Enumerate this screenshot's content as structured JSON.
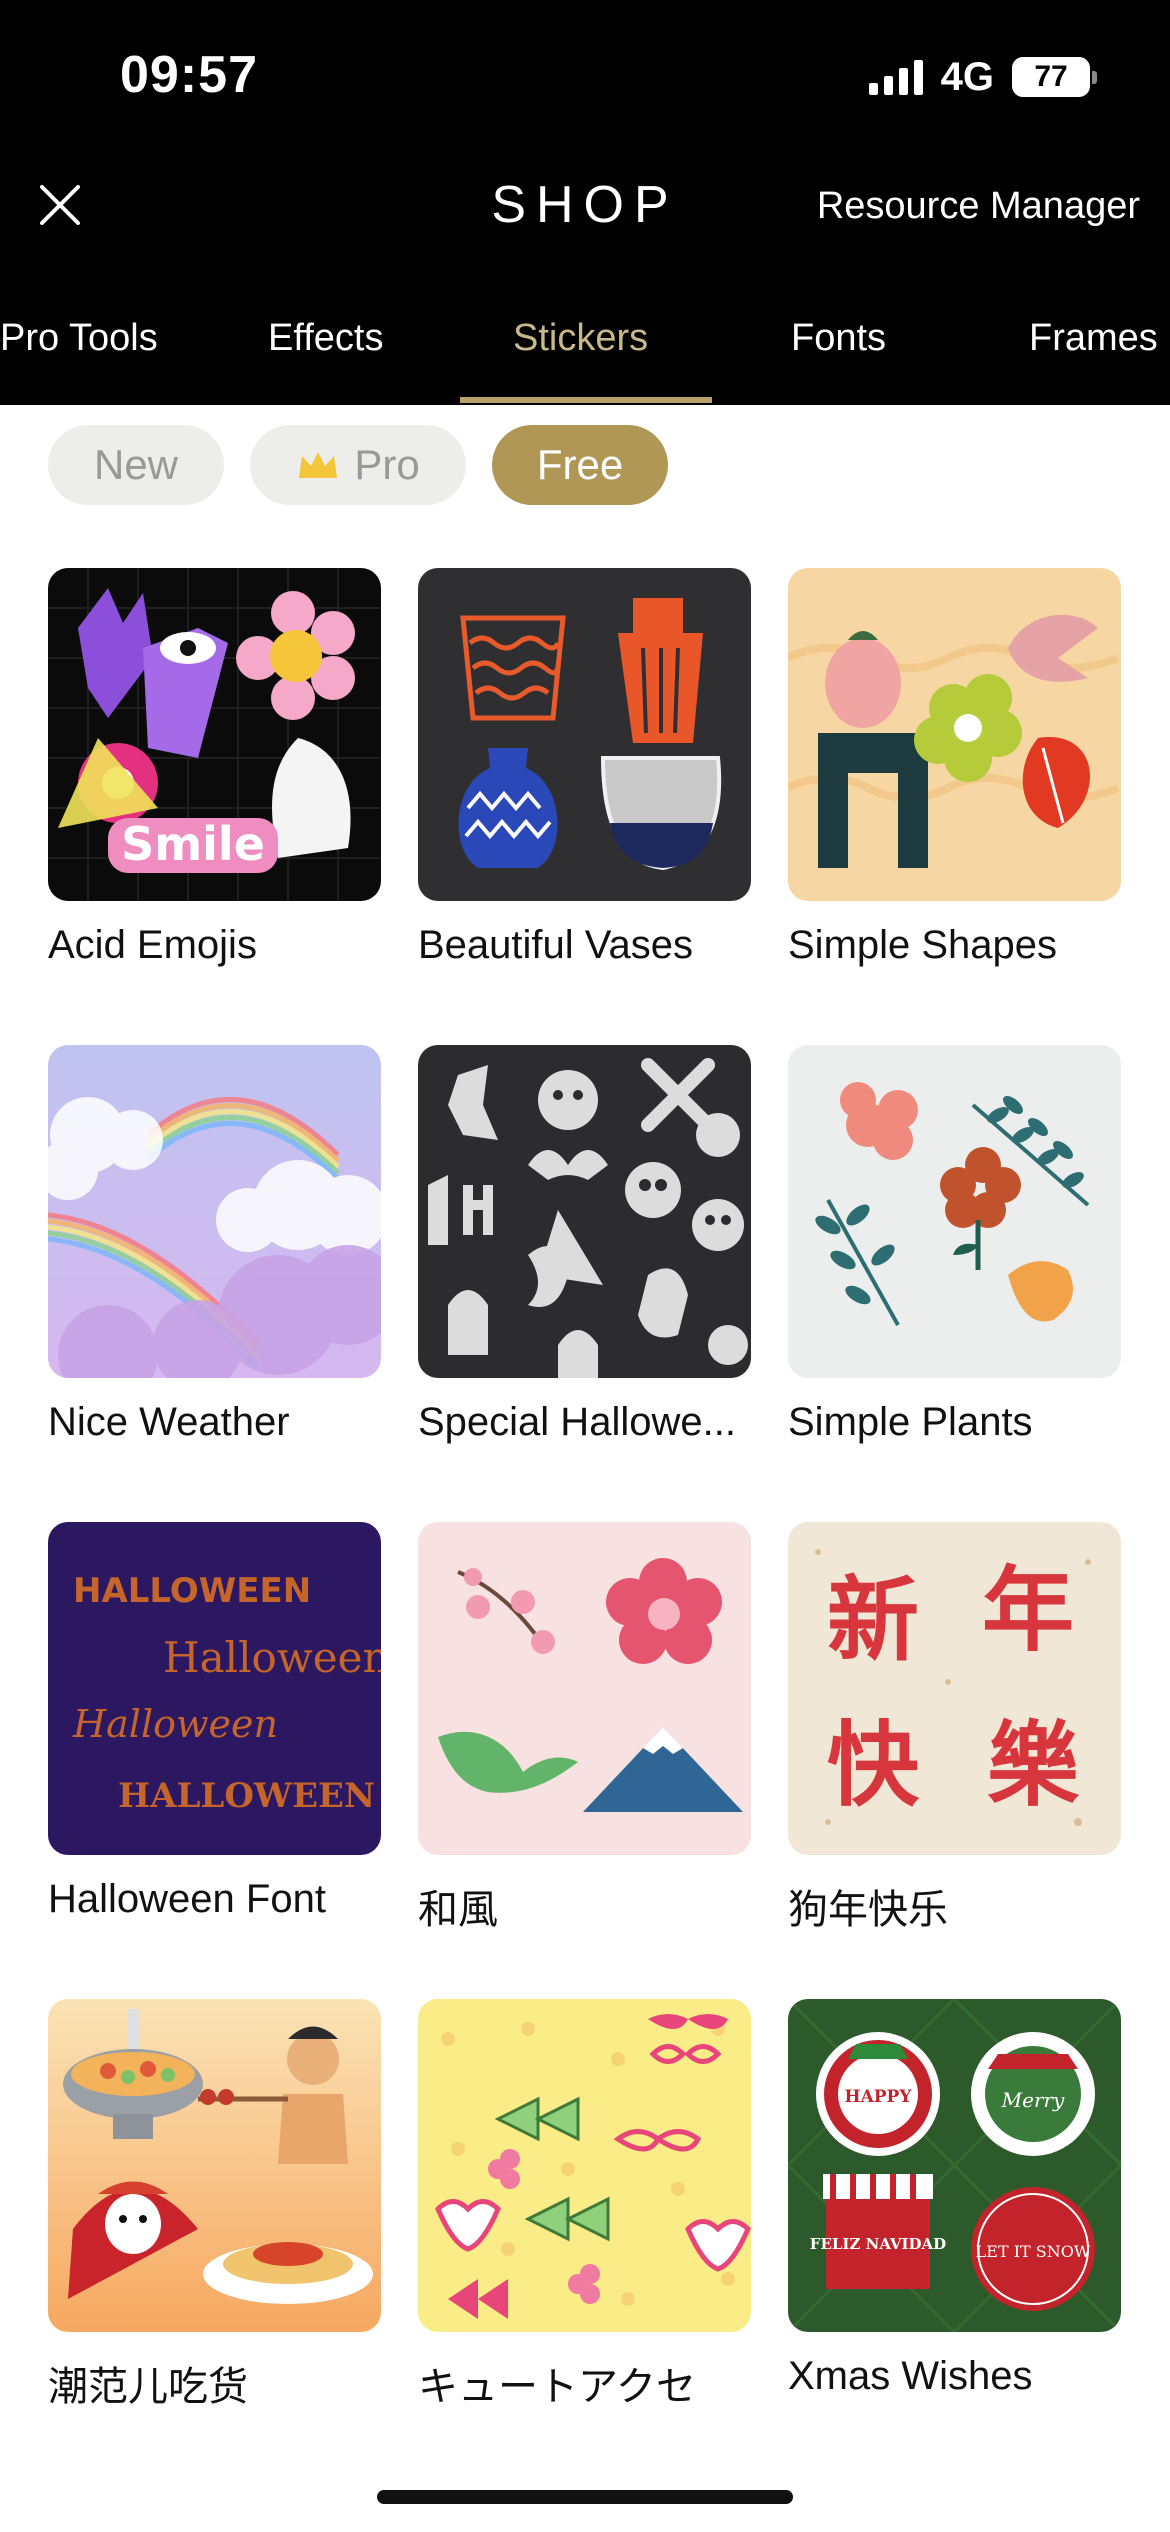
{
  "status_bar": {
    "time": "09:57",
    "network": "4G",
    "battery": "77"
  },
  "header": {
    "title": "SHOP",
    "resource_manager": "Resource Manager"
  },
  "tabs": [
    {
      "label": "Pro Tools",
      "active": false
    },
    {
      "label": "Effects",
      "active": false
    },
    {
      "label": "Stickers",
      "active": true
    },
    {
      "label": "Fonts",
      "active": false
    },
    {
      "label": "Frames",
      "active": false
    }
  ],
  "filters": [
    {
      "label": "New",
      "active": false
    },
    {
      "label": "Pro",
      "active": false
    },
    {
      "label": "Free",
      "active": true
    }
  ],
  "items": [
    {
      "label": "Acid Emojis",
      "icon": "acid-emojis"
    },
    {
      "label": "Beautiful Vases",
      "icon": "vases"
    },
    {
      "label": "Simple Shapes",
      "icon": "shapes"
    },
    {
      "label": "Nice Weather",
      "icon": "rainbow"
    },
    {
      "label": "Special Hallowe...",
      "icon": "halloween-pattern"
    },
    {
      "label": "Simple Plants",
      "icon": "plants"
    },
    {
      "label": "Halloween Font",
      "icon": "halloween-font",
      "art_text": [
        "HALLOWEEN",
        "Halloween",
        "Halloween",
        "HALLOWEEN"
      ]
    },
    {
      "label": "和風",
      "icon": "japanese-style"
    },
    {
      "label": "狗年快乐",
      "icon": "new-year",
      "art_text": [
        "新",
        "年",
        "快",
        "樂"
      ]
    },
    {
      "label": "潮范儿吃货",
      "icon": "foodie"
    },
    {
      "label": "キュートアクセ",
      "icon": "cute-accessories"
    },
    {
      "label": "Xmas Wishes",
      "icon": "xmas",
      "art_text": [
        "HAPPY",
        "Merry",
        "FELIZ NAVIDAD",
        "LET IT SNOW"
      ]
    }
  ],
  "colors": {
    "accent_gold": "#b09755",
    "active_tab": "#c9b98a",
    "header_bg": "#000000"
  }
}
